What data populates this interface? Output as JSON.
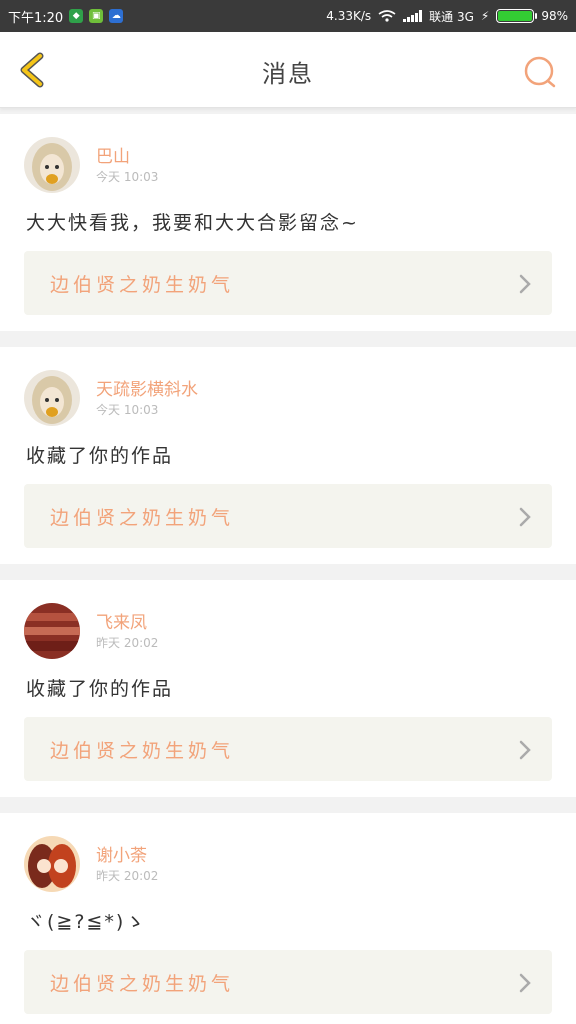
{
  "status_bar": {
    "time": "下午1:20",
    "net_speed": "4.33K/s",
    "carrier": "联通 3G",
    "battery_percent": "98%",
    "battery_level": 0.98
  },
  "header": {
    "title": "消息"
  },
  "messages": [
    {
      "name": "巴山",
      "time": "今天 10:03",
      "text": "大大快看我，我要和大大合影留念~",
      "ref": "边伯贤之奶生奶气"
    },
    {
      "name": "天疏影横斜水",
      "time": "今天 10:03",
      "text": "收藏了你的作品",
      "ref": "边伯贤之奶生奶气"
    },
    {
      "name": "飞来凤",
      "time": "昨天 20:02",
      "text": "收藏了你的作品",
      "ref": "边伯贤之奶生奶气"
    },
    {
      "name": "谢小荼",
      "time": "昨天 20:02",
      "text": "ヾ(≧?≦*)ゝ",
      "ref": "边伯贤之奶生奶气"
    }
  ],
  "colors": {
    "accent": "#f2a37a",
    "back_arrow": "#f5c518",
    "ref_bg": "#f4f4ee"
  }
}
